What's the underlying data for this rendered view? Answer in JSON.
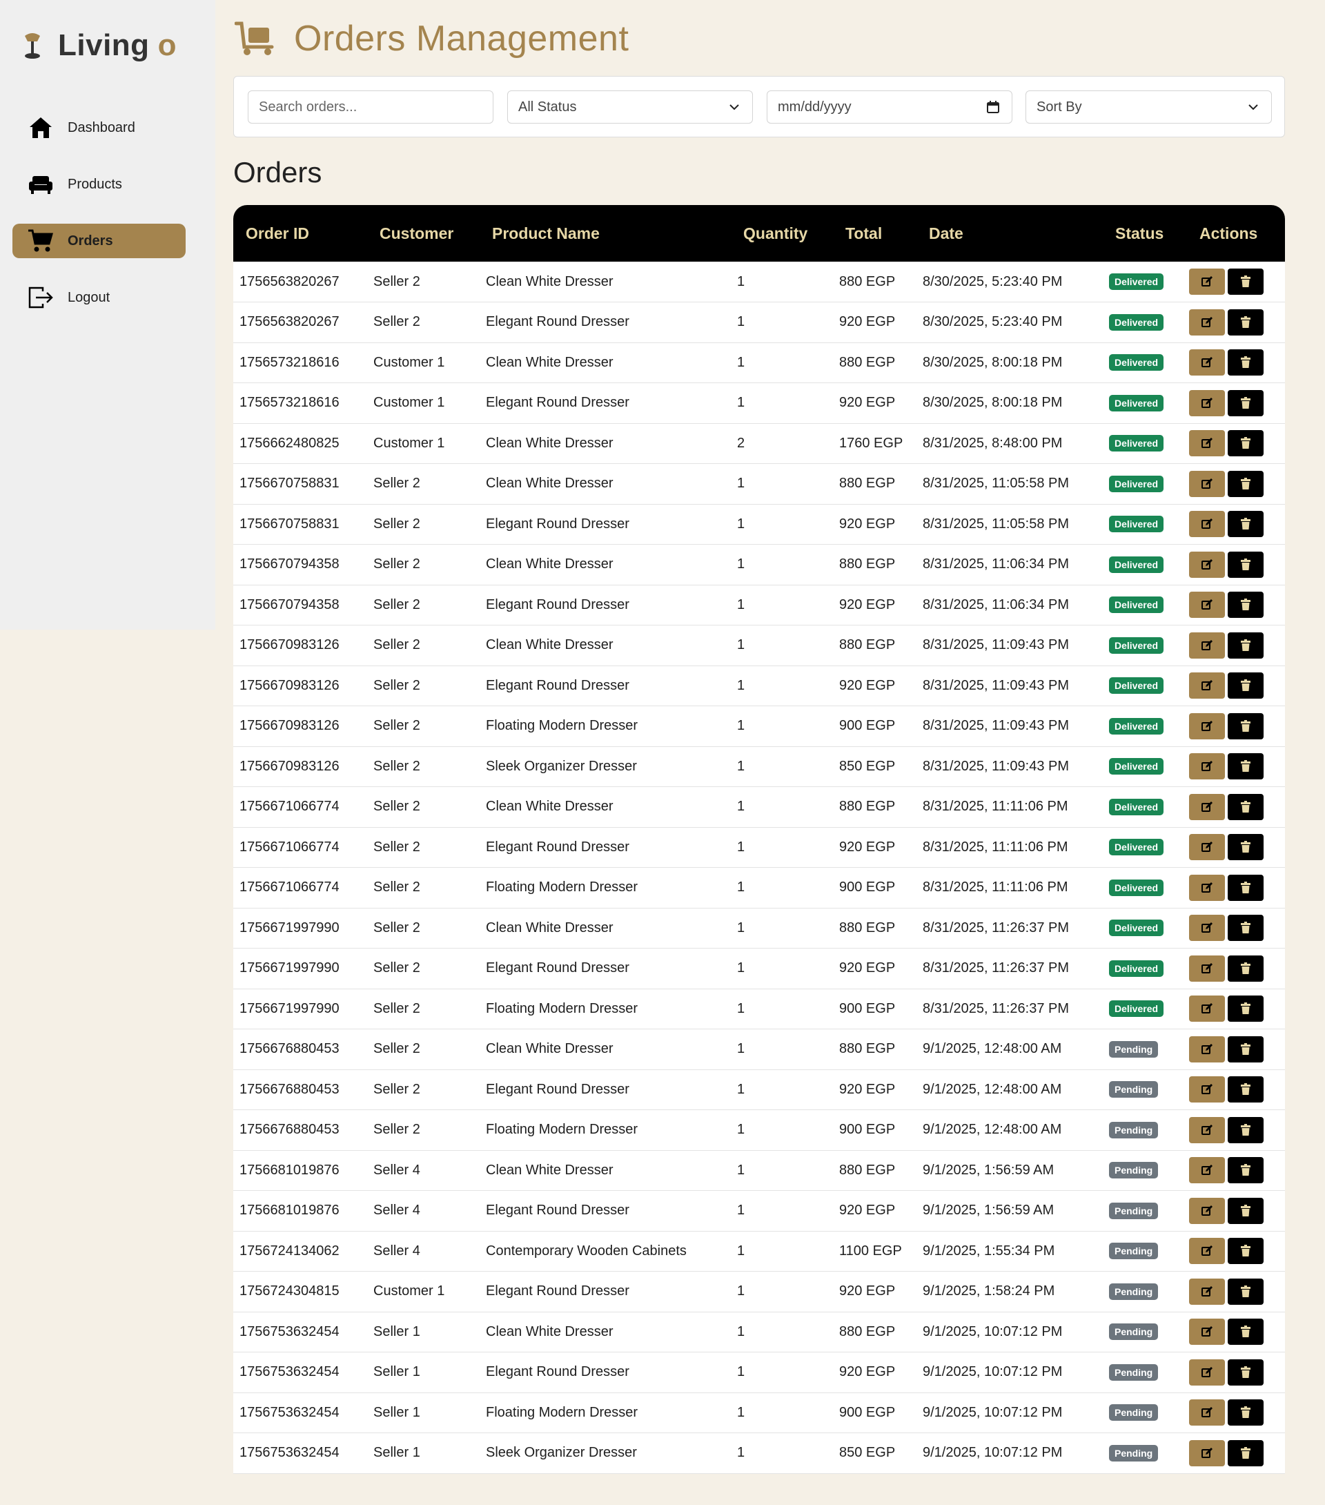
{
  "brand": {
    "name": "Living",
    "accent": "o"
  },
  "nav": [
    {
      "label": "Dashboard",
      "icon": "home-icon"
    },
    {
      "label": "Products",
      "icon": "couch-icon"
    },
    {
      "label": "Orders",
      "icon": "cart-icon",
      "active": true
    },
    {
      "label": "Logout",
      "icon": "logout-icon"
    }
  ],
  "header": {
    "title": "Orders Management",
    "icon": "dolly-icon"
  },
  "filters": {
    "search_placeholder": "Search orders...",
    "status_value": "All Status",
    "date_placeholder": "mm/dd/yyyy",
    "sort_value": "Sort By"
  },
  "section_title": "Orders",
  "table": {
    "columns": [
      "Order ID",
      "Customer",
      "Product Name",
      "Quantity",
      "Total",
      "Date",
      "Status",
      "Actions"
    ],
    "rows": [
      {
        "id": "1756563820267",
        "customer": "Seller 2",
        "product": "Clean White Dresser",
        "qty": "1",
        "total": "880 EGP",
        "date": "8/30/2025, 5:23:40 PM",
        "status": "Delivered"
      },
      {
        "id": "1756563820267",
        "customer": "Seller 2",
        "product": "Elegant Round Dresser",
        "qty": "1",
        "total": "920 EGP",
        "date": "8/30/2025, 5:23:40 PM",
        "status": "Delivered"
      },
      {
        "id": "1756573218616",
        "customer": "Customer 1",
        "product": "Clean White Dresser",
        "qty": "1",
        "total": "880 EGP",
        "date": "8/30/2025, 8:00:18 PM",
        "status": "Delivered"
      },
      {
        "id": "1756573218616",
        "customer": "Customer 1",
        "product": "Elegant Round Dresser",
        "qty": "1",
        "total": "920 EGP",
        "date": "8/30/2025, 8:00:18 PM",
        "status": "Delivered"
      },
      {
        "id": "1756662480825",
        "customer": "Customer 1",
        "product": "Clean White Dresser",
        "qty": "2",
        "total": "1760 EGP",
        "date": "8/31/2025, 8:48:00 PM",
        "status": "Delivered"
      },
      {
        "id": "1756670758831",
        "customer": "Seller 2",
        "product": "Clean White Dresser",
        "qty": "1",
        "total": "880 EGP",
        "date": "8/31/2025, 11:05:58 PM",
        "status": "Delivered"
      },
      {
        "id": "1756670758831",
        "customer": "Seller 2",
        "product": "Elegant Round Dresser",
        "qty": "1",
        "total": "920 EGP",
        "date": "8/31/2025, 11:05:58 PM",
        "status": "Delivered"
      },
      {
        "id": "1756670794358",
        "customer": "Seller 2",
        "product": "Clean White Dresser",
        "qty": "1",
        "total": "880 EGP",
        "date": "8/31/2025, 11:06:34 PM",
        "status": "Delivered"
      },
      {
        "id": "1756670794358",
        "customer": "Seller 2",
        "product": "Elegant Round Dresser",
        "qty": "1",
        "total": "920 EGP",
        "date": "8/31/2025, 11:06:34 PM",
        "status": "Delivered"
      },
      {
        "id": "1756670983126",
        "customer": "Seller 2",
        "product": "Clean White Dresser",
        "qty": "1",
        "total": "880 EGP",
        "date": "8/31/2025, 11:09:43 PM",
        "status": "Delivered"
      },
      {
        "id": "1756670983126",
        "customer": "Seller 2",
        "product": "Elegant Round Dresser",
        "qty": "1",
        "total": "920 EGP",
        "date": "8/31/2025, 11:09:43 PM",
        "status": "Delivered"
      },
      {
        "id": "1756670983126",
        "customer": "Seller 2",
        "product": "Floating Modern Dresser",
        "qty": "1",
        "total": "900 EGP",
        "date": "8/31/2025, 11:09:43 PM",
        "status": "Delivered"
      },
      {
        "id": "1756670983126",
        "customer": "Seller 2",
        "product": "Sleek Organizer Dresser",
        "qty": "1",
        "total": "850 EGP",
        "date": "8/31/2025, 11:09:43 PM",
        "status": "Delivered"
      },
      {
        "id": "1756671066774",
        "customer": "Seller 2",
        "product": "Clean White Dresser",
        "qty": "1",
        "total": "880 EGP",
        "date": "8/31/2025, 11:11:06 PM",
        "status": "Delivered"
      },
      {
        "id": "1756671066774",
        "customer": "Seller 2",
        "product": "Elegant Round Dresser",
        "qty": "1",
        "total": "920 EGP",
        "date": "8/31/2025, 11:11:06 PM",
        "status": "Delivered"
      },
      {
        "id": "1756671066774",
        "customer": "Seller 2",
        "product": "Floating Modern Dresser",
        "qty": "1",
        "total": "900 EGP",
        "date": "8/31/2025, 11:11:06 PM",
        "status": "Delivered"
      },
      {
        "id": "1756671997990",
        "customer": "Seller 2",
        "product": "Clean White Dresser",
        "qty": "1",
        "total": "880 EGP",
        "date": "8/31/2025, 11:26:37 PM",
        "status": "Delivered"
      },
      {
        "id": "1756671997990",
        "customer": "Seller 2",
        "product": "Elegant Round Dresser",
        "qty": "1",
        "total": "920 EGP",
        "date": "8/31/2025, 11:26:37 PM",
        "status": "Delivered"
      },
      {
        "id": "1756671997990",
        "customer": "Seller 2",
        "product": "Floating Modern Dresser",
        "qty": "1",
        "total": "900 EGP",
        "date": "8/31/2025, 11:26:37 PM",
        "status": "Delivered"
      },
      {
        "id": "1756676880453",
        "customer": "Seller 2",
        "product": "Clean White Dresser",
        "qty": "1",
        "total": "880 EGP",
        "date": "9/1/2025, 12:48:00 AM",
        "status": "Pending"
      },
      {
        "id": "1756676880453",
        "customer": "Seller 2",
        "product": "Elegant Round Dresser",
        "qty": "1",
        "total": "920 EGP",
        "date": "9/1/2025, 12:48:00 AM",
        "status": "Pending"
      },
      {
        "id": "1756676880453",
        "customer": "Seller 2",
        "product": "Floating Modern Dresser",
        "qty": "1",
        "total": "900 EGP",
        "date": "9/1/2025, 12:48:00 AM",
        "status": "Pending"
      },
      {
        "id": "1756681019876",
        "customer": "Seller 4",
        "product": "Clean White Dresser",
        "qty": "1",
        "total": "880 EGP",
        "date": "9/1/2025, 1:56:59 AM",
        "status": "Pending"
      },
      {
        "id": "1756681019876",
        "customer": "Seller 4",
        "product": "Elegant Round Dresser",
        "qty": "1",
        "total": "920 EGP",
        "date": "9/1/2025, 1:56:59 AM",
        "status": "Pending"
      },
      {
        "id": "1756724134062",
        "customer": "Seller 4",
        "product": "Contemporary Wooden Cabinets",
        "qty": "1",
        "total": "1100 EGP",
        "date": "9/1/2025, 1:55:34 PM",
        "status": "Pending"
      },
      {
        "id": "1756724304815",
        "customer": "Customer 1",
        "product": "Elegant Round Dresser",
        "qty": "1",
        "total": "920 EGP",
        "date": "9/1/2025, 1:58:24 PM",
        "status": "Pending"
      },
      {
        "id": "1756753632454",
        "customer": "Seller 1",
        "product": "Clean White Dresser",
        "qty": "1",
        "total": "880 EGP",
        "date": "9/1/2025, 10:07:12 PM",
        "status": "Pending"
      },
      {
        "id": "1756753632454",
        "customer": "Seller 1",
        "product": "Elegant Round Dresser",
        "qty": "1",
        "total": "920 EGP",
        "date": "9/1/2025, 10:07:12 PM",
        "status": "Pending"
      },
      {
        "id": "1756753632454",
        "customer": "Seller 1",
        "product": "Floating Modern Dresser",
        "qty": "1",
        "total": "900 EGP",
        "date": "9/1/2025, 10:07:12 PM",
        "status": "Pending"
      },
      {
        "id": "1756753632454",
        "customer": "Seller 1",
        "product": "Sleek Organizer Dresser",
        "qty": "1",
        "total": "850 EGP",
        "date": "9/1/2025, 10:07:12 PM",
        "status": "Pending"
      }
    ]
  },
  "colors": {
    "accent": "#a4844e",
    "page_bg": "#f5f0e6",
    "sidebar_bg": "#efefef",
    "header_bg": "#000000",
    "header_text": "#e7d8a7",
    "delivered": "#198754",
    "pending": "#6c757d"
  }
}
